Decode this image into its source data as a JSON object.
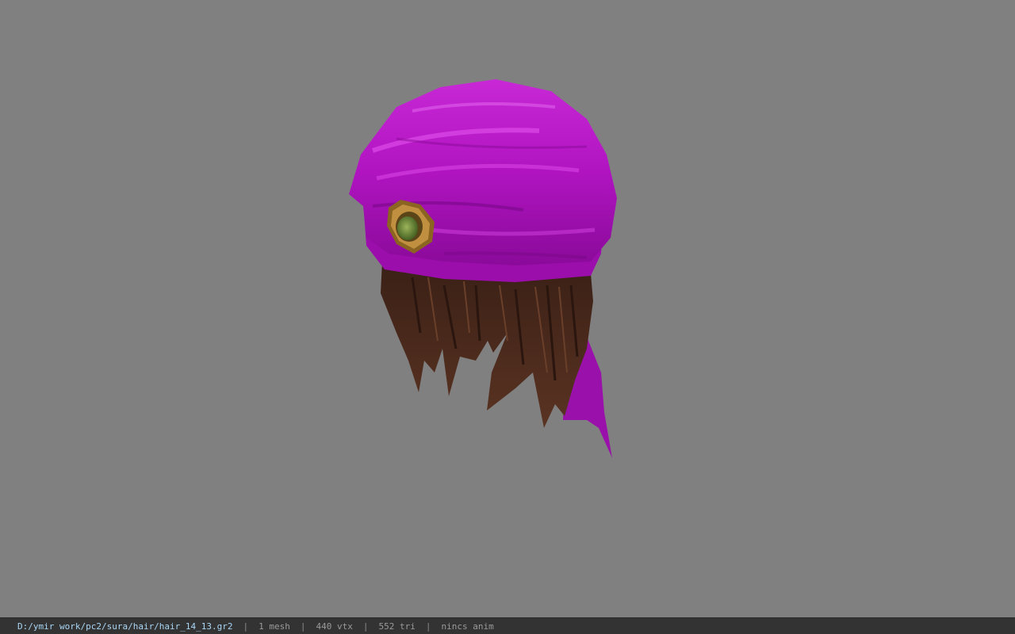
{
  "viewport": {
    "background_color": "#808080",
    "model_name": "hair_14_13",
    "colors": {
      "bandana": "#b415c2",
      "bandana_highlight": "#d640e0",
      "hair": "#4a2a1a",
      "gem": "#6b8a3a",
      "gem_rim": "#a0782a"
    }
  },
  "status": {
    "path": "D:/ymir work/pc2/sura/hair/hair_14_13.gr2",
    "separator": "|",
    "mesh": "1 mesh",
    "vtx": "440 vtx",
    "tri": "552 tri",
    "anim": "nincs anim"
  }
}
